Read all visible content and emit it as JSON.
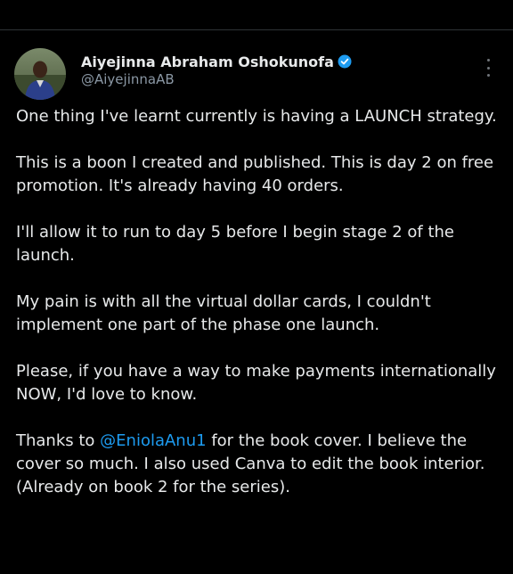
{
  "tweet": {
    "author": {
      "display_name": "Aiyejinna Abraham Oshokunofa",
      "handle": "@AiyejinnaAB",
      "verified_icon": "verified-badge-icon",
      "verified_color": "#1d9bf0"
    },
    "more_icon": "more-options-icon",
    "paragraphs": [
      {
        "text": "One thing I've learnt currently is having a LAUNCH strategy."
      },
      {
        "text": "This is a boon I created and published. This is day 2 on free promotion. It's already having 40 orders."
      },
      {
        "text": "I'll allow it to run to day 5 before I begin stage 2 of the launch."
      },
      {
        "text": "My pain is with all the virtual dollar cards, I couldn't implement one part of the phase one launch."
      },
      {
        "text": "Please, if you have a way to make payments internationally NOW, I'd love to know."
      }
    ],
    "last_paragraph": {
      "prefix": "Thanks to ",
      "mention": "@EniolaAnu1",
      "suffix": " for the book cover. I believe the cover so much. I also used Canva to edit the book interior. (Already on book 2 for the series)."
    }
  },
  "colors": {
    "background": "#000000",
    "text": "#e7e9ea",
    "secondary_text": "#8b98a5",
    "link": "#1d9bf0"
  }
}
